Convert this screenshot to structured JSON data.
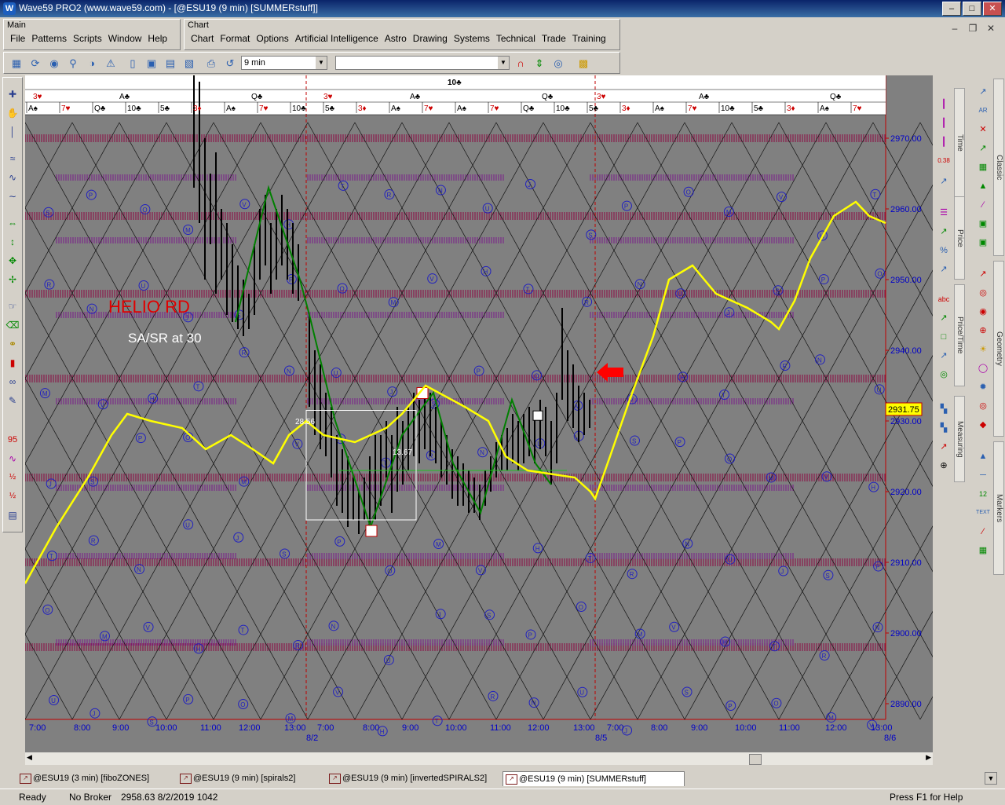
{
  "window": {
    "title": "Wave59 PRO2 (www.wave59.com) - [@ESU19 (9 min) [SUMMERstuff]]",
    "app_icon": "W",
    "minimize": "–",
    "maximize": "□",
    "close": "✕"
  },
  "main_panel": {
    "title": "Main",
    "menu": [
      "File",
      "Patterns",
      "Scripts",
      "Window",
      "Help"
    ]
  },
  "chart_panel": {
    "title": "Chart",
    "menu": [
      "Chart",
      "Format",
      "Options",
      "Artificial Intelligence",
      "Astro",
      "Drawing",
      "Systems",
      "Technical",
      "Trade",
      "Training"
    ]
  },
  "toolbar": {
    "interval": "9 min",
    "symbol": ""
  },
  "chart": {
    "header_top": "10♣",
    "overlay_title": "HELIO RD",
    "overlay_subtitle": "SA/SR at 30",
    "last_price": "2931.75",
    "label_a": "28.56",
    "label_b": "13.67",
    "price_ticks": [
      "2970.00",
      "2960.00",
      "2950.00",
      "2940.00",
      "2930.00",
      "2920.00",
      "2910.00",
      "2900.00",
      "2890.00"
    ],
    "time_ticks": [
      "7:00",
      "8:00",
      "9:00",
      "10:00",
      "11:00",
      "12:00",
      "13:00",
      "7:00",
      "8:00",
      "9:00",
      "10:00",
      "11:00",
      "12:00",
      "13:00",
      "7:00",
      "8:00",
      "9:00",
      "10:00",
      "11:00",
      "12:00",
      "13:00"
    ],
    "date_ticks": [
      "8/2",
      "8/5",
      "8/6"
    ],
    "card_row1": [
      "3♥",
      "A♣",
      "Q♣",
      "3♥",
      "A♣",
      "Q♣",
      "3♥",
      "A♣",
      "Q♣"
    ],
    "card_row2": [
      "A♠",
      "7♥",
      "Q♣",
      "10♣",
      "5♣",
      "3♦",
      "A♠",
      "7♥",
      "10♣",
      "5♣",
      "3♦",
      "A♠",
      "7♥",
      "A♠",
      "7♥",
      "Q♣",
      "10♣",
      "5♣",
      "3♦",
      "A♠",
      "7♥",
      "10♣",
      "5♣",
      "3♦",
      "A♠",
      "7♥"
    ],
    "colors": {
      "background": "#808080",
      "price_line": "#ffff00",
      "wave": "#008000",
      "zone": "#8b1a4a",
      "circles": "#2020c0",
      "axis_text": "#0000c8",
      "arrow": "#ff0000"
    }
  },
  "right_tabs": [
    "Classic",
    "Time",
    "Price",
    "Geometry",
    "Price/Time",
    "Measuring",
    "Markers"
  ],
  "doc_tabs": [
    {
      "label": "@ESU19 (3 min) [fiboZONES]",
      "active": false
    },
    {
      "label": "@ESU19 (9 min) [spirals2]",
      "active": false
    },
    {
      "label": "@ESU19 (9 min) [invertedSPIRALS2]",
      "active": false
    },
    {
      "label": "@ESU19 (9 min) [SUMMERstuff]",
      "active": true
    }
  ],
  "status": {
    "ready": "Ready",
    "broker": "No Broker",
    "quote": "2958.63  8/2/2019  1042",
    "help": "Press F1 for Help"
  }
}
